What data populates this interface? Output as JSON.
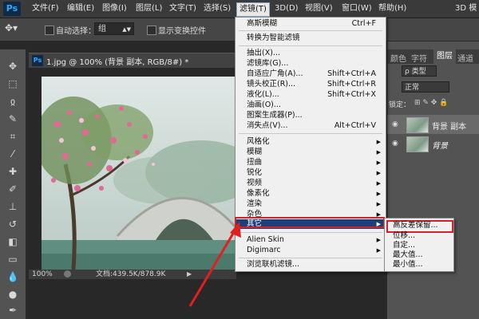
{
  "app": {
    "logo": "Ps",
    "accent": "#31a8ff"
  },
  "menubar": {
    "items": [
      "文件(F)",
      "编辑(E)",
      "图像(I)",
      "图层(L)",
      "文字(T)",
      "选择(S)",
      "滤镜(T)",
      "3D(D)",
      "视图(V)",
      "窗口(W)",
      "帮助(H)"
    ],
    "workspace": "3D 模"
  },
  "options": {
    "auto_select_label": "自动选择：",
    "auto_select_value": "组",
    "show_transform_label": "显示变换控件"
  },
  "document": {
    "title": "1.jpg @ 100% (背景 副本, RGB/8#) *",
    "zoom": "100%",
    "doc_size": "文档:439.5K/878.9K"
  },
  "panels": {
    "tabs": [
      "颜色",
      "字符",
      "图层",
      "通道"
    ],
    "kind": "ρ 类型",
    "blend_mode": "正常",
    "lock_label": "锁定：",
    "layers": [
      {
        "name": "背景 副本"
      },
      {
        "name": "背景"
      }
    ]
  },
  "filter_menu": {
    "items": [
      {
        "label": "高斯模糊",
        "shortcut": "Ctrl+F"
      },
      {
        "label": "转换为智能滤镜",
        "shortcut": ""
      },
      {
        "label": "抽出(X)...",
        "shortcut": ""
      },
      {
        "label": "滤镜库(G)...",
        "shortcut": ""
      },
      {
        "label": "自适应广角(A)...",
        "shortcut": "Shift+Ctrl+A"
      },
      {
        "label": "镜头校正(R)...",
        "shortcut": "Shift+Ctrl+R"
      },
      {
        "label": "液化(L)...",
        "shortcut": "Shift+Ctrl+X"
      },
      {
        "label": "油画(O)...",
        "shortcut": ""
      },
      {
        "label": "图案生成器(P)...",
        "shortcut": ""
      },
      {
        "label": "消失点(V)...",
        "shortcut": "Alt+Ctrl+V"
      },
      {
        "label": "风格化",
        "shortcut": ""
      },
      {
        "label": "模糊",
        "shortcut": ""
      },
      {
        "label": "扭曲",
        "shortcut": ""
      },
      {
        "label": "锐化",
        "shortcut": ""
      },
      {
        "label": "视频",
        "shortcut": ""
      },
      {
        "label": "像素化",
        "shortcut": ""
      },
      {
        "label": "渲染",
        "shortcut": ""
      },
      {
        "label": "杂色",
        "shortcut": ""
      },
      {
        "label": "其它",
        "shortcut": ""
      },
      {
        "label": "Alien Skin",
        "shortcut": ""
      },
      {
        "label": "Digimarc",
        "shortcut": ""
      },
      {
        "label": "浏览联机滤镜...",
        "shortcut": ""
      }
    ]
  },
  "submenu": {
    "items": [
      "高反差保留...",
      "位移...",
      "自定...",
      "最大值...",
      "最小值..."
    ]
  }
}
